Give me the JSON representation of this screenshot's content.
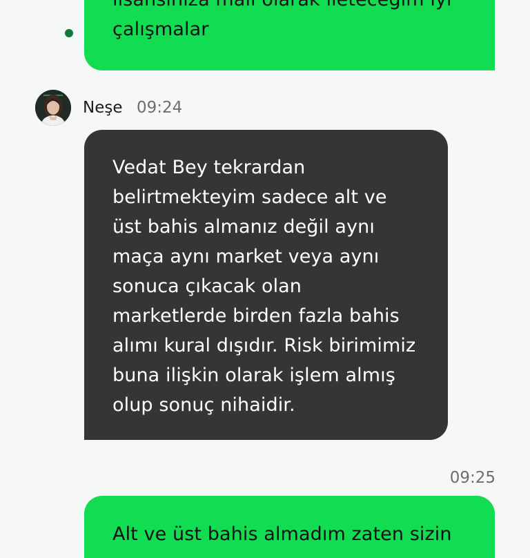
{
  "messages": {
    "outgoing_previous": {
      "lines": [
        "lisansınıza mail olarak ileteceğim iyi",
        "çalışmalar"
      ]
    },
    "incoming": {
      "sender": "Neşe",
      "time": "09:24",
      "lines": [
        "Vedat Bey tekrardan",
        "belirtmekteyim sadece alt ve",
        "üst bahis almanız değil aynı",
        "maça aynı market veya aynı",
        "sonuca çıkacak olan",
        "marketlerde birden fazla bahis",
        "alımı kural dışıdır. Risk birimimiz",
        "buna ilişkin olarak işlem almış",
        "olup sonuç nihaidir."
      ]
    },
    "outgoing_next": {
      "time": "09:25",
      "lines": [
        "Alt ve üst bahis almadım zaten sizin"
      ]
    }
  },
  "colors": {
    "outgoing_bubble": "#12dc52",
    "incoming_bubble": "#353535",
    "background": "#f6f8f7",
    "status_dot": "#0f7a3c"
  },
  "icons": {
    "avatar": "agent-avatar-photo",
    "status": "online-status-dot"
  }
}
